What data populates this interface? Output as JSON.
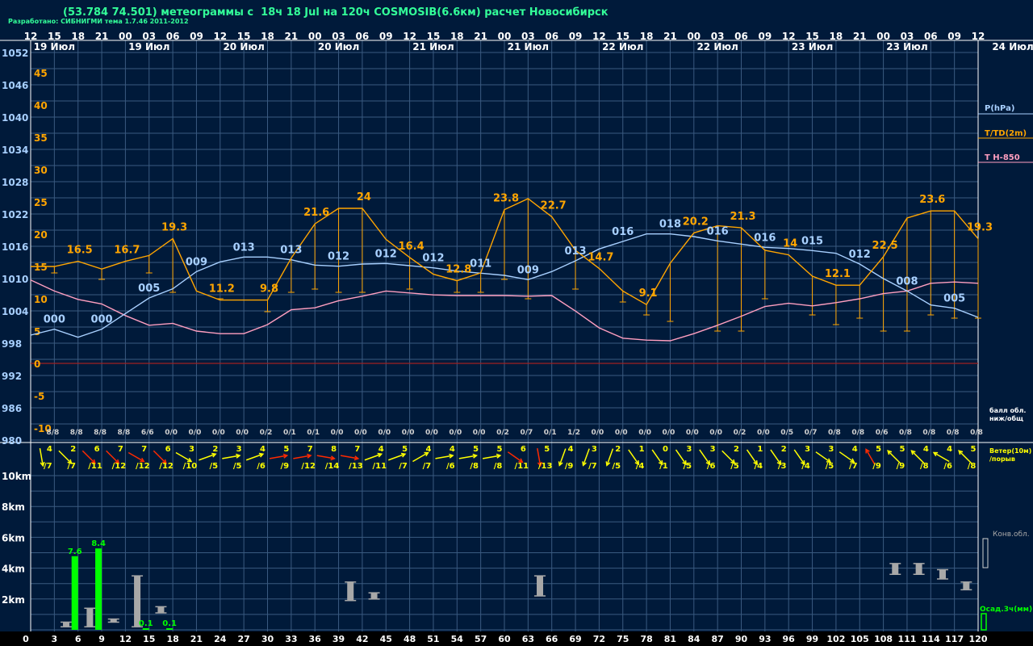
{
  "title": "(53.784 74.501) метеограммы с  18ч 18 Jul на 120ч COSMOSIB(6.6км) расчет Новосибирск",
  "credit": "Разработано: СИБНИГМИ тема 1.7.46 2011-2012",
  "colors": {
    "background": "#001a3a",
    "grid": "#3a5a80",
    "pressure": "#a8d0ff",
    "temperature": "#ffa500",
    "t850": "#ff9fc0",
    "zero_line": "#a02020",
    "wind_yellow": "#ffff00",
    "wind_red": "#ff2a00",
    "precip": "#00ff00",
    "cloud": "#a8a8a8",
    "label_white": "#ffffff"
  },
  "top_hours": [
    "12",
    "15",
    "18",
    "21",
    "00",
    "03",
    "06",
    "09",
    "12",
    "15",
    "18",
    "21",
    "00",
    "03",
    "06",
    "09",
    "12",
    "15",
    "18",
    "21",
    "00",
    "03",
    "06",
    "09",
    "12",
    "15",
    "18",
    "21",
    "00",
    "03",
    "06",
    "09",
    "12",
    "15",
    "18",
    "21",
    "00",
    "03",
    "06",
    "09",
    "12"
  ],
  "date_labels": [
    "19 Июл",
    "19 Июл",
    "20 Июл",
    "20 Июл",
    "21 Июл",
    "21 Июл",
    "22 Июл",
    "22 Июл",
    "23 Июл",
    "23 Июл",
    "24 Июл"
  ],
  "legend": {
    "pressure": "P(hPa)",
    "temperature": "T/TD(2m)",
    "t850": "T H-850",
    "cloud_cover": "балл обл.\nниж/общ",
    "wind": "Ветер(10м)\n/порыв",
    "conv_cloud": "Конв.обл.",
    "precip": "Осад.3ч(мм)"
  },
  "pressure_axis": [
    "1052",
    "1046",
    "1040",
    "1034",
    "1028",
    "1022",
    "1016",
    "1010",
    "1004",
    "998",
    "992",
    "986",
    "980"
  ],
  "temp_axis": [
    "45",
    "40",
    "35",
    "30",
    "25",
    "20",
    "15",
    "10",
    "5",
    "0",
    "-5",
    "-10"
  ],
  "height_axis": [
    "10km",
    "8km",
    "6km",
    "4km",
    "2km"
  ],
  "chart_data": {
    "type": "line",
    "x_hours": [
      0,
      3,
      6,
      9,
      12,
      15,
      18,
      21,
      24,
      27,
      30,
      33,
      36,
      39,
      42,
      45,
      48,
      51,
      54,
      57,
      60,
      63,
      66,
      69,
      72,
      75,
      78,
      81,
      84,
      87,
      90,
      93,
      96,
      99,
      102,
      105,
      108,
      111,
      114,
      117,
      120
    ],
    "x_tick_labels": [
      "0",
      "3",
      "6",
      "9",
      "12",
      "15",
      "18",
      "21",
      "24",
      "27",
      "30",
      "33",
      "36",
      "39",
      "42",
      "45",
      "48",
      "51",
      "54",
      "57",
      "60",
      "63",
      "66",
      "69",
      "72",
      "75",
      "78",
      "81",
      "84",
      "87",
      "90",
      "93",
      "96",
      "99",
      "102",
      "105",
      "108",
      "111",
      "114",
      "117",
      "120"
    ],
    "pressure_ylim": [
      980,
      1052
    ],
    "temp_ylim": [
      -10,
      45
    ],
    "series": [
      {
        "name": "P(hPa)",
        "values": [
          999.5,
          1000.6,
          999.1,
          1000.6,
          1003.5,
          1006.4,
          1008.1,
          1011.3,
          1013.1,
          1014.0,
          1014.0,
          1013.5,
          1012.5,
          1012.3,
          1012.7,
          1012.8,
          1012.4,
          1012.0,
          1011.4,
          1011.0,
          1010.6,
          1009.8,
          1011.3,
          1013.3,
          1015.5,
          1016.9,
          1018.3,
          1018.3,
          1017.8,
          1017.0,
          1016.4,
          1015.8,
          1015.6,
          1015.2,
          1014.7,
          1012.7,
          1010.0,
          1007.7,
          1005.1,
          1004.5,
          1002.8
        ]
      },
      {
        "name": "T/TD(2m)",
        "values": [
          15.0,
          15.0,
          15.8,
          14.6,
          15.8,
          16.7,
          19.3,
          11.2,
          9.8,
          9.8,
          9.8,
          16.3,
          21.6,
          24.0,
          24.0,
          19.2,
          16.4,
          13.8,
          12.8,
          14.0,
          23.8,
          25.5,
          22.7,
          17.5,
          14.7,
          11.2,
          9.1,
          15.5,
          20.2,
          21.3,
          21.0,
          17.5,
          16.8,
          13.5,
          12.1,
          12.1,
          16.5,
          22.5,
          23.6,
          23.6,
          19.3
        ]
      },
      {
        "name": "T H-850",
        "values": [
          12.9,
          11.2,
          9.9,
          9.2,
          7.4,
          5.9,
          6.2,
          5.0,
          4.6,
          4.6,
          6.0,
          8.3,
          8.6,
          9.7,
          10.4,
          11.2,
          10.9,
          10.6,
          10.5,
          10.5,
          10.5,
          10.4,
          10.5,
          8.1,
          5.5,
          3.9,
          3.6,
          3.5,
          4.6,
          5.9,
          7.3,
          8.8,
          9.3,
          8.9,
          9.4,
          10.0,
          10.8,
          11.2,
          12.4,
          12.6,
          12.4
        ]
      }
    ],
    "temperature_labels": [
      {
        "x": 6,
        "text": "16.5"
      },
      {
        "x": 12,
        "text": "16.7"
      },
      {
        "x": 18,
        "text": "19.3"
      },
      {
        "x": 24,
        "text": "11.2"
      },
      {
        "x": 30,
        "text": "9.8"
      },
      {
        "x": 36,
        "text": "21.6"
      },
      {
        "x": 42,
        "text": "24"
      },
      {
        "x": 48,
        "text": "16.4"
      },
      {
        "x": 54,
        "text": "12.8"
      },
      {
        "x": 60,
        "text": "23.8"
      },
      {
        "x": 66,
        "text": "22.7"
      },
      {
        "x": 72,
        "text": "14.7"
      },
      {
        "x": 78,
        "text": "9.1"
      },
      {
        "x": 84,
        "text": "20.2"
      },
      {
        "x": 90,
        "text": "21.3"
      },
      {
        "x": 96,
        "text": "14"
      },
      {
        "x": 102,
        "text": "12.1"
      },
      {
        "x": 108,
        "text": "22.5"
      },
      {
        "x": 114,
        "text": "23.6"
      },
      {
        "x": 120,
        "text": "19.3"
      }
    ],
    "pressure_labels": [
      {
        "x": 3,
        "text": "000"
      },
      {
        "x": 9,
        "text": "000"
      },
      {
        "x": 15,
        "text": "005"
      },
      {
        "x": 21,
        "text": "009"
      },
      {
        "x": 27,
        "text": "013"
      },
      {
        "x": 33,
        "text": "013"
      },
      {
        "x": 39,
        "text": "012"
      },
      {
        "x": 45,
        "text": "012"
      },
      {
        "x": 51,
        "text": "012"
      },
      {
        "x": 57,
        "text": "011"
      },
      {
        "x": 63,
        "text": "009"
      },
      {
        "x": 69,
        "text": "013"
      },
      {
        "x": 75,
        "text": "016"
      },
      {
        "x": 81,
        "text": "018"
      },
      {
        "x": 87,
        "text": "016"
      },
      {
        "x": 93,
        "text": "016"
      },
      {
        "x": 99,
        "text": "015"
      },
      {
        "x": 105,
        "text": "012"
      },
      {
        "x": 111,
        "text": "008"
      },
      {
        "x": 117,
        "text": "005"
      }
    ],
    "dewpoint_drops": [
      {
        "x": 3,
        "t": 14.0
      },
      {
        "x": 9,
        "t": 13.0
      },
      {
        "x": 15,
        "t": 14.0
      },
      {
        "x": 18,
        "t": 11.0
      },
      {
        "x": 24,
        "t": 10.0
      },
      {
        "x": 30,
        "t": 8.0
      },
      {
        "x": 33,
        "t": 11.0
      },
      {
        "x": 36,
        "t": 11.5
      },
      {
        "x": 39,
        "t": 11.0
      },
      {
        "x": 42,
        "t": 11.0
      },
      {
        "x": 48,
        "t": 11.5
      },
      {
        "x": 54,
        "t": 11.0
      },
      {
        "x": 57,
        "t": 11.0
      },
      {
        "x": 60,
        "t": 13.0
      },
      {
        "x": 63,
        "t": 10.0
      },
      {
        "x": 69,
        "t": 11.5
      },
      {
        "x": 75,
        "t": 9.5
      },
      {
        "x": 78,
        "t": 7.5
      },
      {
        "x": 81,
        "t": 6.5
      },
      {
        "x": 87,
        "t": 5.0
      },
      {
        "x": 90,
        "t": 5.0
      },
      {
        "x": 93,
        "t": 10.0
      },
      {
        "x": 99,
        "t": 7.5
      },
      {
        "x": 102,
        "t": 6.0
      },
      {
        "x": 105,
        "t": 7.0
      },
      {
        "x": 108,
        "t": 5.0
      },
      {
        "x": 111,
        "t": 5.0
      },
      {
        "x": 114,
        "t": 7.5
      },
      {
        "x": 117,
        "t": 7.0
      },
      {
        "x": 120,
        "t": 7.0
      }
    ],
    "cloud_cover": [
      "8/8",
      "8/8",
      "8/8",
      "8/8",
      "6/6",
      "0/0",
      "0/0",
      "0/0",
      "0/0",
      "0/2",
      "0/1",
      "0/1",
      "0/0",
      "0/0",
      "0/0",
      "0/0",
      "0/0",
      "0/0",
      "0/0",
      "0/2",
      "0/7",
      "0/1",
      "1/2",
      "0/0",
      "0/0",
      "0/0",
      "0/0",
      "0/0",
      "0/0",
      "0/2",
      "0/0",
      "0/5",
      "0/7",
      "0/8",
      "0/8",
      "0/6",
      "0/8",
      "0/8",
      "0/8",
      "0/8"
    ],
    "wind": [
      {
        "x": 3,
        "speed": "4",
        "gust": "/7",
        "dir": 170,
        "red": false
      },
      {
        "x": 6,
        "speed": "2",
        "gust": "/7",
        "dir": 135,
        "red": false
      },
      {
        "x": 9,
        "speed": "6",
        "gust": "/11",
        "dir": 135,
        "red": true
      },
      {
        "x": 12,
        "speed": "7",
        "gust": "/12",
        "dir": 135,
        "red": true
      },
      {
        "x": 15,
        "speed": "7",
        "gust": "/12",
        "dir": 120,
        "red": true
      },
      {
        "x": 18,
        "speed": "6",
        "gust": "/12",
        "dir": 135,
        "red": true
      },
      {
        "x": 21,
        "speed": "3",
        "gust": "/10",
        "dir": 120,
        "red": false
      },
      {
        "x": 24,
        "speed": "2",
        "gust": "/5",
        "dir": 70,
        "red": false
      },
      {
        "x": 27,
        "speed": "3",
        "gust": "/5",
        "dir": 80,
        "red": false
      },
      {
        "x": 30,
        "speed": "4",
        "gust": "/6",
        "dir": 70,
        "red": false
      },
      {
        "x": 33,
        "speed": "5",
        "gust": "/9",
        "dir": 80,
        "red": true
      },
      {
        "x": 36,
        "speed": "7",
        "gust": "/12",
        "dir": 80,
        "red": true
      },
      {
        "x": 39,
        "speed": "8",
        "gust": "/14",
        "dir": 100,
        "red": true
      },
      {
        "x": 42,
        "speed": "7",
        "gust": "/13",
        "dir": 100,
        "red": true
      },
      {
        "x": 45,
        "speed": "4",
        "gust": "/11",
        "dir": 70,
        "red": false
      },
      {
        "x": 48,
        "speed": "5",
        "gust": "/7",
        "dir": 70,
        "red": false
      },
      {
        "x": 51,
        "speed": "4",
        "gust": "/7",
        "dir": 60,
        "red": false
      },
      {
        "x": 54,
        "speed": "4",
        "gust": "/6",
        "dir": 80,
        "red": false
      },
      {
        "x": 57,
        "speed": "5",
        "gust": "/8",
        "dir": 80,
        "red": false
      },
      {
        "x": 60,
        "speed": "5",
        "gust": "/8",
        "dir": 80,
        "red": false
      },
      {
        "x": 63,
        "speed": "6",
        "gust": "/11",
        "dir": 125,
        "red": true
      },
      {
        "x": 66,
        "speed": "5",
        "gust": "/13",
        "dir": 170,
        "red": true
      },
      {
        "x": 69,
        "speed": "4",
        "gust": "/9",
        "dir": 200,
        "red": false
      },
      {
        "x": 72,
        "speed": "3",
        "gust": "/7",
        "dir": 200,
        "red": false
      },
      {
        "x": 75,
        "speed": "2",
        "gust": "/5",
        "dir": 200,
        "red": false
      },
      {
        "x": 78,
        "speed": "1",
        "gust": "/4",
        "dir": 145,
        "red": false
      },
      {
        "x": 81,
        "speed": "0",
        "gust": "/1",
        "dir": 145,
        "red": false
      },
      {
        "x": 84,
        "speed": "3",
        "gust": "/5",
        "dir": 145,
        "red": false
      },
      {
        "x": 87,
        "speed": "3",
        "gust": "/6",
        "dir": 145,
        "red": false
      },
      {
        "x": 90,
        "speed": "2",
        "gust": "/5",
        "dir": 135,
        "red": false
      },
      {
        "x": 93,
        "speed": "1",
        "gust": "/4",
        "dir": 145,
        "red": false
      },
      {
        "x": 96,
        "speed": "2",
        "gust": "/3",
        "dir": 145,
        "red": false
      },
      {
        "x": 99,
        "speed": "3",
        "gust": "/4",
        "dir": 145,
        "red": false
      },
      {
        "x": 102,
        "speed": "3",
        "gust": "/5",
        "dir": 125,
        "red": false
      },
      {
        "x": 105,
        "speed": "4",
        "gust": "/7",
        "dir": 125,
        "red": false
      },
      {
        "x": 108,
        "speed": "5",
        "gust": "/9",
        "dir": 330,
        "red": true
      },
      {
        "x": 111,
        "speed": "5",
        "gust": "/9",
        "dir": 315,
        "red": false
      },
      {
        "x": 114,
        "speed": "4",
        "gust": "/8",
        "dir": 315,
        "red": false
      },
      {
        "x": 117,
        "speed": "4",
        "gust": "/6",
        "dir": 300,
        "red": false
      },
      {
        "x": 120,
        "speed": "5",
        "gust": "/8",
        "dir": 315,
        "red": false
      }
    ],
    "precipitation": [
      {
        "x": 6,
        "mm": 7.6,
        "label": "7.6"
      },
      {
        "x": 9,
        "mm": 8.4,
        "label": "8.4"
      },
      {
        "x": 15,
        "mm": 0.1,
        "label": "0.1"
      },
      {
        "x": 18,
        "mm": 0.1,
        "label": "0.1"
      }
    ],
    "convective_clouds_km": [
      {
        "x": 4.5,
        "base": 0.2,
        "top": 0.5
      },
      {
        "x": 7.5,
        "base": 0.2,
        "top": 1.4
      },
      {
        "x": 10.5,
        "base": 0.5,
        "top": 0.7
      },
      {
        "x": 13.5,
        "base": 0.2,
        "top": 3.5
      },
      {
        "x": 16.5,
        "base": 1.1,
        "top": 1.5
      },
      {
        "x": 40.5,
        "base": 1.9,
        "top": 3.1
      },
      {
        "x": 43.5,
        "base": 2.0,
        "top": 2.4
      },
      {
        "x": 64.5,
        "base": 2.2,
        "top": 3.5
      },
      {
        "x": 109.5,
        "base": 3.6,
        "top": 4.3
      },
      {
        "x": 112.5,
        "base": 3.6,
        "top": 4.3
      },
      {
        "x": 115.5,
        "base": 3.3,
        "top": 3.9
      },
      {
        "x": 118.5,
        "base": 2.6,
        "top": 3.1
      }
    ]
  }
}
